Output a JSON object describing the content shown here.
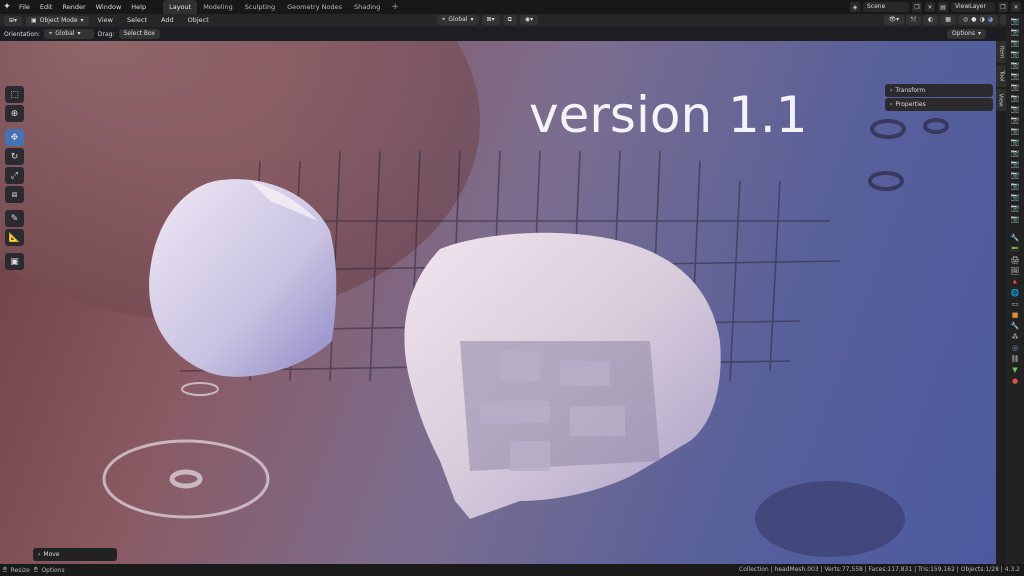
{
  "topbar": {
    "menus": [
      "File",
      "Edit",
      "Render",
      "Window",
      "Help"
    ],
    "workspaces": [
      "Layout",
      "Modeling",
      "Sculpting",
      "Geometry Nodes",
      "Shading"
    ],
    "active_workspace": "Layout",
    "scene": "Scene",
    "view_layer": "ViewLayer"
  },
  "header": {
    "mode": "Object Mode",
    "menus": [
      "View",
      "Select",
      "Add",
      "Object"
    ],
    "transform_orientation": "Global"
  },
  "toolsettings": {
    "orientation_label": "Orientation:",
    "orientation_value": "Global",
    "drag_label": "Drag:",
    "drag_value": "Select Box",
    "options": "Options"
  },
  "viewport": {
    "overlay_text": "version 1.1"
  },
  "npanel": {
    "panels": [
      "Transform",
      "Properties"
    ],
    "tabs": [
      "Item",
      "Tool",
      "View"
    ]
  },
  "last_operator": "Move",
  "statusbar": {
    "resize": "Resize",
    "options": "Options",
    "stats": "Collection | headMesh.003 | Verts:77,558 | Faces:117,831 | Tris:159,162 | Objects:1/28 | 4.3.2"
  },
  "icons": [
    "blender-logo-icon",
    "select-box-tool-icon",
    "cursor-tool-icon",
    "move-tool-icon",
    "rotate-tool-icon",
    "scale-tool-icon",
    "transform-tool-icon",
    "annotate-tool-icon",
    "measure-tool-icon",
    "add-cube-tool-icon"
  ],
  "colors": {
    "active_tool": "#4772b3",
    "ui_dark": "#1d1d1d"
  }
}
